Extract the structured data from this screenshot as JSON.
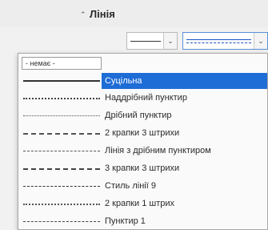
{
  "section": {
    "toggle_glyph": "⌃",
    "title": "Лінія"
  },
  "controls": {
    "style_combo_arrow": "⌄",
    "width_combo_arrow": "⌄",
    "active_combo_arrow": "⌄"
  },
  "dropdown": {
    "none_label": "- немає -",
    "items": [
      {
        "label": "Суцільна",
        "pattern": "solid",
        "selected": true
      },
      {
        "label": "Наддрібний пунктир",
        "pattern": "fine-dash",
        "selected": false
      },
      {
        "label": "Дрібний пунктир",
        "pattern": "dot",
        "selected": false
      },
      {
        "label": "2 крапки 3 штрихи",
        "pattern": "dot-dash",
        "selected": false
      },
      {
        "label": "Лінія з дрібним пунктиром",
        "pattern": "line-dot",
        "selected": false
      },
      {
        "label": "3 крапки 3 штрихи",
        "pattern": "dash-dot",
        "selected": false
      },
      {
        "label": "Стиль лінії 9",
        "pattern": "short-dash",
        "selected": false
      },
      {
        "label": "2 крапки 1 штрих",
        "pattern": "dot-dot-dash",
        "selected": false
      },
      {
        "label": "Пунктир 1",
        "pattern": "dash",
        "selected": false
      }
    ]
  },
  "colors": {
    "accent": "#1e6cd6",
    "line": "#333333"
  }
}
